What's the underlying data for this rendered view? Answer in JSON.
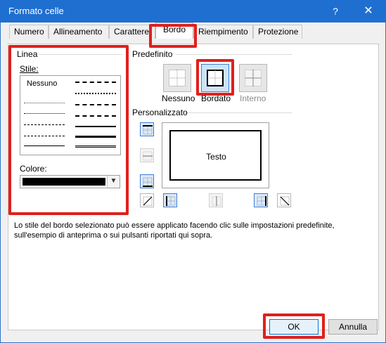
{
  "window": {
    "title": "Formato celle",
    "help_label": "?",
    "close_label": "✕"
  },
  "tabs": [
    {
      "label": "Numero"
    },
    {
      "label": "Allineamento"
    },
    {
      "label": "Carattere"
    },
    {
      "label": "Bordo",
      "active": true
    },
    {
      "label": "Riempimento"
    },
    {
      "label": "Protezione"
    }
  ],
  "line": {
    "group_label": "Linea",
    "style_label": "Stile:",
    "style_none": "Nessuno",
    "color_label": "Colore:",
    "color_value": "#000000"
  },
  "presets": {
    "group_label": "Predefinito",
    "items": [
      {
        "label": "Nessuno",
        "icon": "border-none-icon"
      },
      {
        "label": "Bordato",
        "icon": "border-outline-icon"
      },
      {
        "label": "Interno",
        "icon": "border-inside-icon",
        "disabled": true
      }
    ]
  },
  "custom": {
    "group_label": "Personalizzato",
    "preview_text": "Testo"
  },
  "info_text": "Lo stile del bordo selezionato può essere applicato facendo clic sulle impostazioni predefinite, sull'esempio di anteprima o sui pulsanti riportati qui sopra.",
  "footer": {
    "ok_label": "OK",
    "cancel_label": "Annulla"
  },
  "highlight_color": "#e0201c"
}
